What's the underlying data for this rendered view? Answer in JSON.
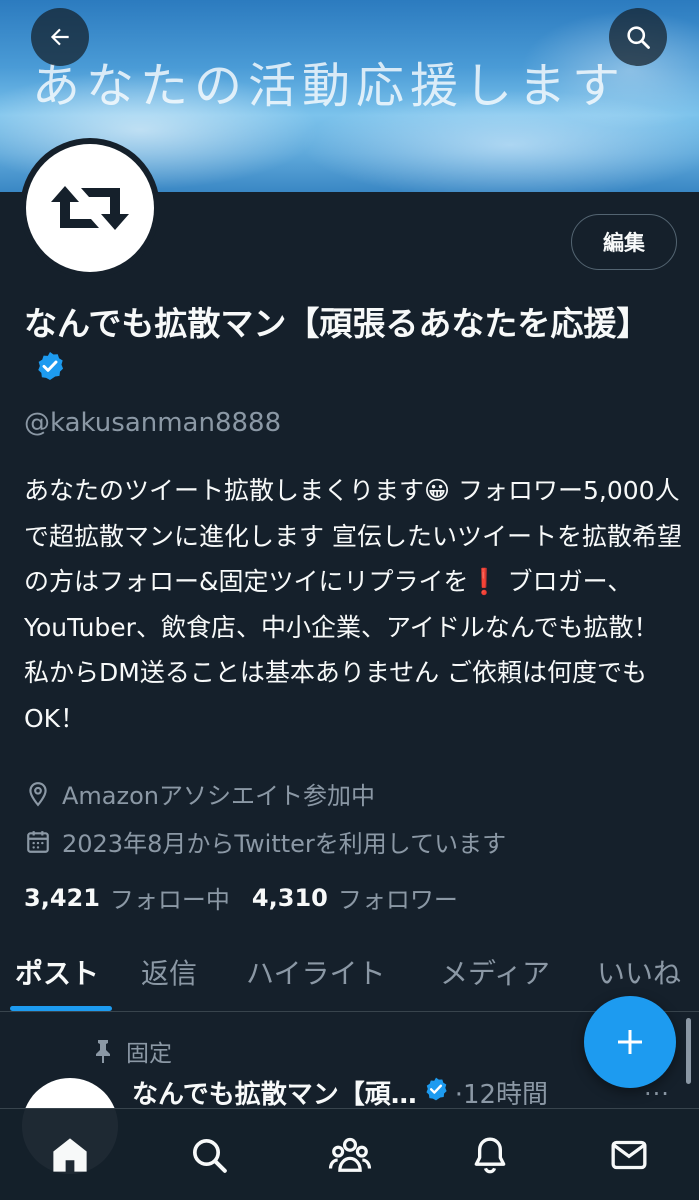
{
  "banner": {
    "text": "あなたの活動応援します"
  },
  "profile": {
    "edit_label": "編集",
    "name": "なんでも拡散マン【頑張るあなたを応援】",
    "handle": "@kakusanman8888",
    "bio": "あなたのツイート拡散しまくります😀 フォロワー5,000人で超拡散マンに進化します 宣伝したいツイートを拡散希望の方はフォロー&固定ツイにリプライを❗️ ブロガー、YouTuber、飲食店、中小企業、アイドルなんでも拡散！ 私からDM送ることは基本ありません ご依頼は何度でもOK！",
    "location": "Amazonアソシエイト参加中",
    "joined": "2023年8月からTwitterを利用しています",
    "following_count": "3,421",
    "following_label": "フォロー中",
    "followers_count": "4,310",
    "followers_label": "フォロワー"
  },
  "tabs": [
    {
      "label": "ポスト"
    },
    {
      "label": "返信"
    },
    {
      "label": "ハイライト"
    },
    {
      "label": "メディア"
    },
    {
      "label": "いいね"
    }
  ],
  "pinned_post": {
    "pinned_label": "固定",
    "author": "なんでも拡散マン【頑…",
    "time": "·12時間",
    "more": "···"
  },
  "icons": {
    "back": "arrow-left-icon",
    "search": "search-icon",
    "verified": "verified-badge-icon",
    "location": "location-pin-icon",
    "calendar": "calendar-icon",
    "pin": "pin-icon",
    "compose": "plus-icon",
    "nav": [
      "home-icon",
      "search-icon",
      "communities-icon",
      "bell-icon",
      "mail-icon"
    ]
  },
  "colors": {
    "accent": "#1d9bf0",
    "background": "#15202b",
    "muted": "#8b98a5"
  }
}
